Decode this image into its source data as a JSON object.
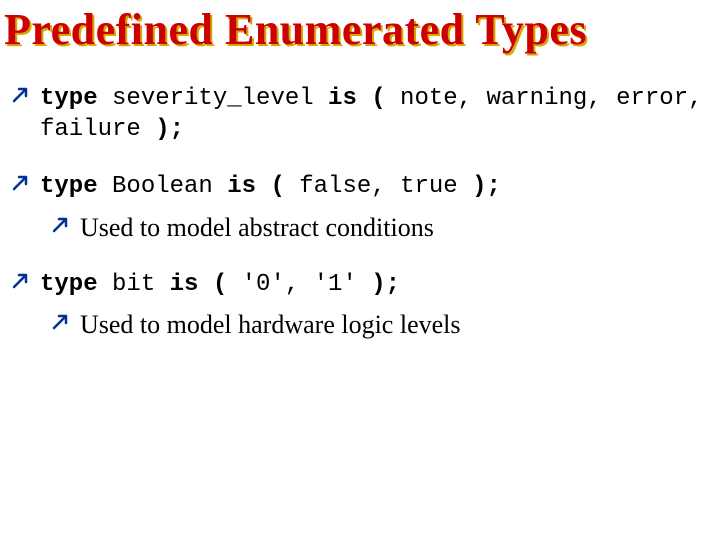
{
  "title": "Predefined Enumerated Types",
  "items": [
    {
      "code": "<span class='kw'>type</span> severity_level <span class='kw'>is (</span> note, warning, error, failure <span class='kw'>);</span>",
      "sub": null
    },
    {
      "code": "<span class='kw'>type</span> Boolean <span class='kw'>is (</span> false, true <span class='kw'>);</span>",
      "sub": "Used to model abstract conditions"
    },
    {
      "code": "<span class='kw'>type</span> bit <span class='kw'>is (</span> '0', '1' <span class='kw'>);</span>",
      "sub": "Used to model hardware logic levels"
    }
  ]
}
